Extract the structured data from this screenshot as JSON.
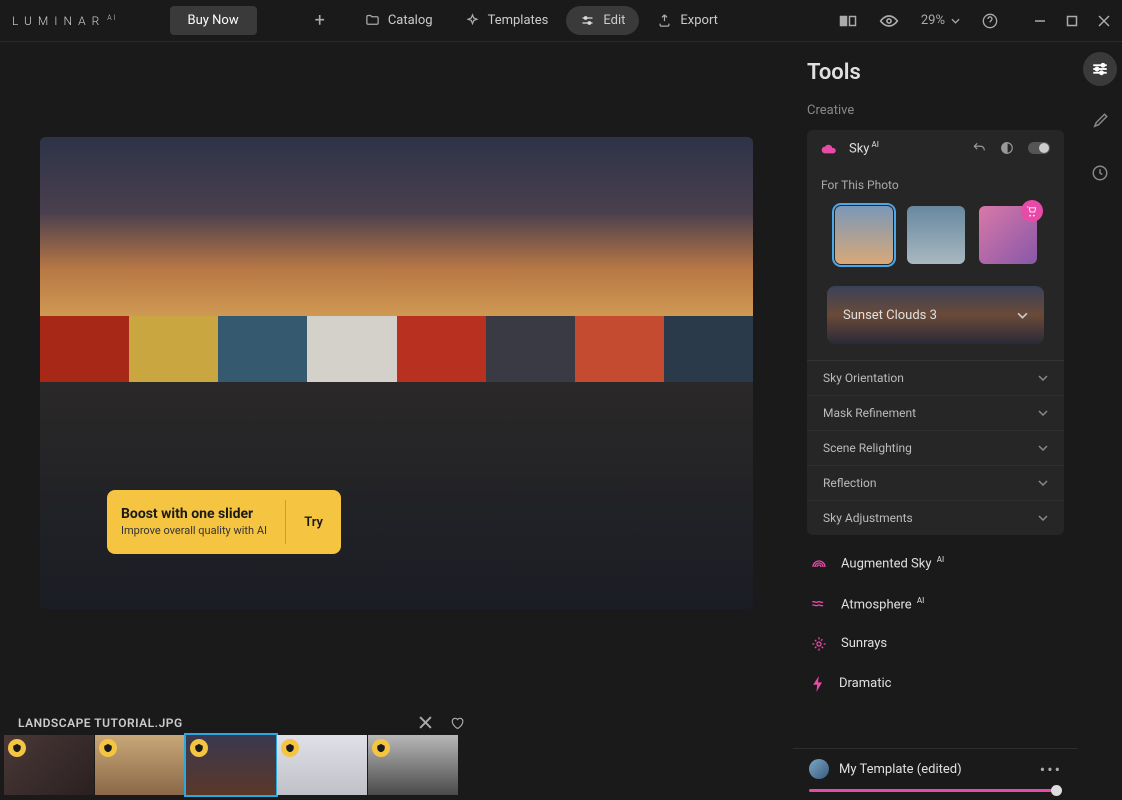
{
  "app": {
    "logo": "LUMINAR",
    "logo_suffix": "AI"
  },
  "topbar": {
    "buy": "Buy Now",
    "nav": {
      "catalog": "Catalog",
      "templates": "Templates",
      "edit": "Edit",
      "export": "Export"
    },
    "zoom": "29%"
  },
  "boost": {
    "title": "Boost with one slider",
    "subtitle": "Improve overall quality with AI",
    "try": "Try"
  },
  "filename": "LANDSCAPE TUTORIAL.JPG",
  "panel": {
    "title": "Tools",
    "section": "Creative",
    "sky": {
      "name": "Sky",
      "ai": "AI",
      "for_this_photo": "For This Photo",
      "selected_preset": "Sunset Clouds 3",
      "accordion": {
        "orientation": "Sky Orientation",
        "mask": "Mask Refinement",
        "relight": "Scene Relighting",
        "reflection": "Reflection",
        "adjust": "Sky Adjustments"
      }
    },
    "tools": {
      "augmented": "Augmented Sky",
      "atmosphere": "Atmosphere",
      "sunrays": "Sunrays",
      "dramatic": "Dramatic",
      "ai": "AI"
    }
  },
  "template": {
    "name": "My Template (edited)"
  }
}
